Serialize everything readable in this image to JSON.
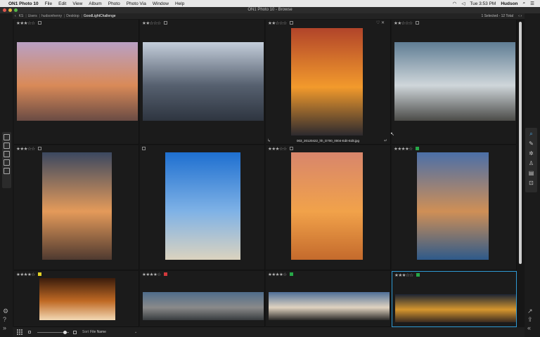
{
  "menubar": {
    "app": "ON1 Photo 10",
    "menus": [
      "File",
      "Edit",
      "View",
      "Album",
      "Photo",
      "Photo Via",
      "Window",
      "Help"
    ],
    "time": "Tue 3:53 PM",
    "user": "Hudson"
  },
  "window": {
    "title": "ON1 Photo 10 - Browse"
  },
  "pathbar": {
    "crumbs": [
      "KS",
      "Users",
      "hudsonhenry",
      "Desktop",
      "GoodLightChallenge"
    ],
    "selection": "1 Selected - 12 Total"
  },
  "photos": [
    {
      "rating": "★★★☆☆",
      "label": "none",
      "colors": [
        "#b9a0c4",
        "#d98a58",
        "#6a4b44"
      ],
      "filename": ""
    },
    {
      "rating": "★★☆☆☆",
      "label": "none",
      "colors": [
        "#c4cedb",
        "#56606f",
        "#2e3540"
      ],
      "filename": ""
    },
    {
      "rating": "★★☆☆☆",
      "label": "none",
      "colors": [
        "#b1442a",
        "#f29a2c",
        "#2d2a2e"
      ],
      "filename": "003_20120422_hh_D700_0004-Edit-Edit.jpg",
      "fav": "♡ ✕"
    },
    {
      "rating": "★★☆☆☆",
      "label": "none",
      "colors": [
        "#5f7d94",
        "#cfd6da",
        "#4b4b48"
      ],
      "filename": ""
    },
    {
      "rating": "★★★☆☆",
      "label": "none",
      "colors": [
        "#3b4860",
        "#e49a5a",
        "#4f3a30"
      ],
      "filename": ""
    },
    {
      "rating": "",
      "label": "none",
      "colors": [
        "#1e6fd0",
        "#7fb2e6",
        "#dbd3bf"
      ],
      "filename": ""
    },
    {
      "rating": "★★★☆☆",
      "label": "none",
      "colors": [
        "#d8866c",
        "#f1a24a",
        "#c46a2c"
      ],
      "filename": ""
    },
    {
      "rating": "★★★★☆",
      "label": "green",
      "colors": [
        "#4b6fa8",
        "#cf8f56",
        "#2e5a8a"
      ],
      "filename": ""
    },
    {
      "rating": "★★★★☆",
      "label": "yellow",
      "colors": [
        "#3a1c0c",
        "#c06a24",
        "#f2d8b4"
      ],
      "filename": ""
    },
    {
      "rating": "★★★★☆",
      "label": "red",
      "colors": [
        "#4f6c8b",
        "#8a8a8a",
        "#383c3f"
      ],
      "filename": ""
    },
    {
      "rating": "★★★★☆",
      "label": "green",
      "colors": [
        "#4f6f98",
        "#e0d3c0",
        "#2d2b2a"
      ],
      "filename": ""
    },
    {
      "rating": "★★★☆☆",
      "label": "green",
      "colors": [
        "#1c2433",
        "#d5962e",
        "#3a2a20"
      ],
      "filename": "",
      "selected": true
    }
  ],
  "label_colors": {
    "green": "#27a848",
    "yellow": "#e2d126",
    "red": "#d2393b"
  },
  "accent": "#2f9ad4",
  "bottombar": {
    "sort_label": "Sort",
    "sort_value": "File Name"
  }
}
